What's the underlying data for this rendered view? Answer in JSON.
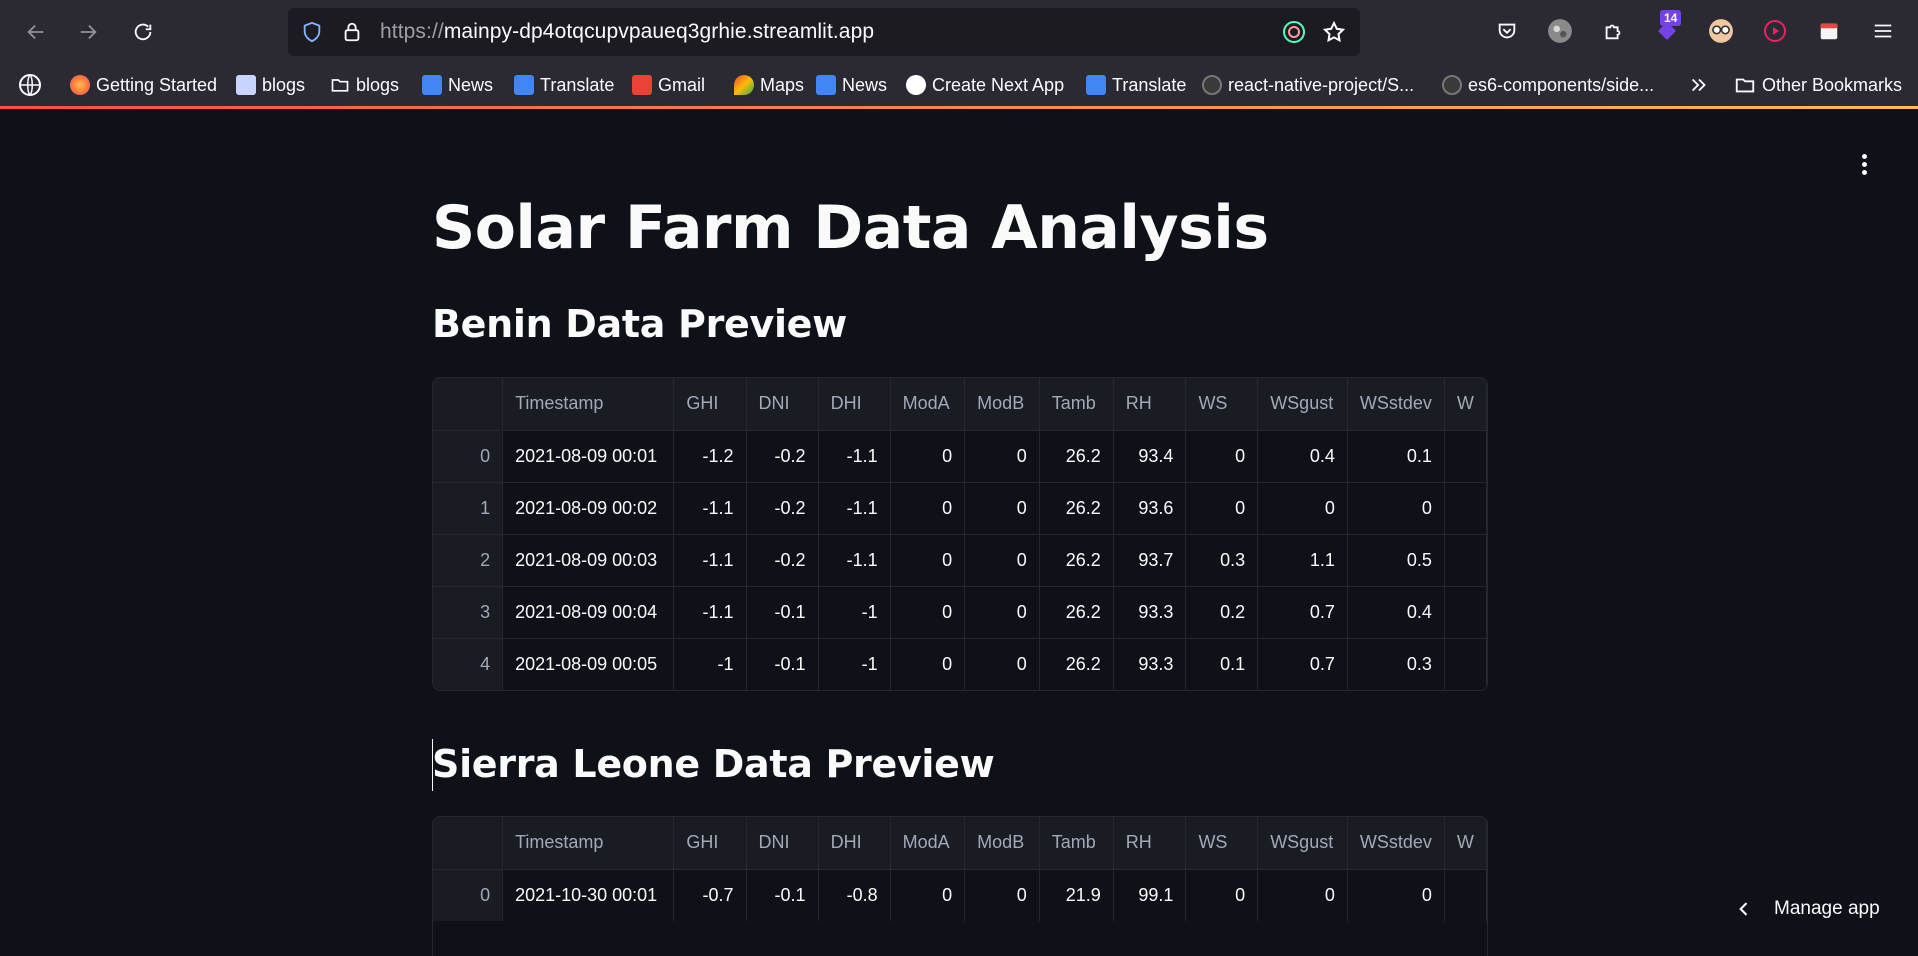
{
  "browser": {
    "url_protocol": "https://",
    "url_host": "mainpy-dp4otqcupvpaueq3grhie.streamlit.app",
    "extensions_badge": "14",
    "bookmarks": [
      {
        "label": "Getting Started",
        "icon": "firefox-icon",
        "color": "#ff7139"
      },
      {
        "label": "blogs",
        "icon": "blog-favicon",
        "color": "#c9d4ff"
      },
      {
        "label": "blogs",
        "icon": "folder-icon",
        "color": "#00000000"
      },
      {
        "label": "News",
        "icon": "google-news-icon",
        "color": "#4285f4"
      },
      {
        "label": "Translate",
        "icon": "google-translate-icon",
        "color": "#4285f4"
      },
      {
        "label": "Gmail",
        "icon": "gmail-icon",
        "color": "#ea4335"
      },
      {
        "label": "Maps",
        "icon": "google-maps-icon",
        "color": "#34a853"
      },
      {
        "label": "News",
        "icon": "google-news-icon",
        "color": "#4285f4"
      },
      {
        "label": "Create Next App",
        "icon": "nextjs-icon",
        "color": "#ffffff"
      },
      {
        "label": "Translate",
        "icon": "google-translate-icon",
        "color": "#4285f4"
      },
      {
        "label": "react-native-project/S...",
        "icon": "github-icon",
        "color": "#3a3a3a"
      },
      {
        "label": "es6-components/side...",
        "icon": "github-icon",
        "color": "#3a3a3a"
      }
    ],
    "other_bookmarks": "Other Bookmarks"
  },
  "app": {
    "title": "Solar Farm Data Analysis",
    "manage_app": "Manage app",
    "columns": [
      "Timestamp",
      "GHI",
      "DNI",
      "DHI",
      "ModA",
      "ModB",
      "Tamb",
      "RH",
      "WS",
      "WSgust",
      "WSstdev",
      "W"
    ],
    "sections": [
      {
        "heading": "Benin Data Preview",
        "rows": [
          [
            "0",
            "2021-08-09 00:01",
            "-1.2",
            "-0.2",
            "-1.1",
            "0",
            "0",
            "26.2",
            "93.4",
            "0",
            "0.4",
            "0.1"
          ],
          [
            "1",
            "2021-08-09 00:02",
            "-1.1",
            "-0.2",
            "-1.1",
            "0",
            "0",
            "26.2",
            "93.6",
            "0",
            "0",
            "0"
          ],
          [
            "2",
            "2021-08-09 00:03",
            "-1.1",
            "-0.2",
            "-1.1",
            "0",
            "0",
            "26.2",
            "93.7",
            "0.3",
            "1.1",
            "0.5"
          ],
          [
            "3",
            "2021-08-09 00:04",
            "-1.1",
            "-0.1",
            "-1",
            "0",
            "0",
            "26.2",
            "93.3",
            "0.2",
            "0.7",
            "0.4"
          ],
          [
            "4",
            "2021-08-09 00:05",
            "-1",
            "-0.1",
            "-1",
            "0",
            "0",
            "26.2",
            "93.3",
            "0.1",
            "0.7",
            "0.3"
          ]
        ]
      },
      {
        "heading": "Sierra Leone Data Preview",
        "rows": [
          [
            "0",
            "2021-10-30 00:01",
            "-0.7",
            "-0.1",
            "-0.8",
            "0",
            "0",
            "21.9",
            "99.1",
            "0",
            "0",
            "0"
          ]
        ]
      }
    ]
  }
}
